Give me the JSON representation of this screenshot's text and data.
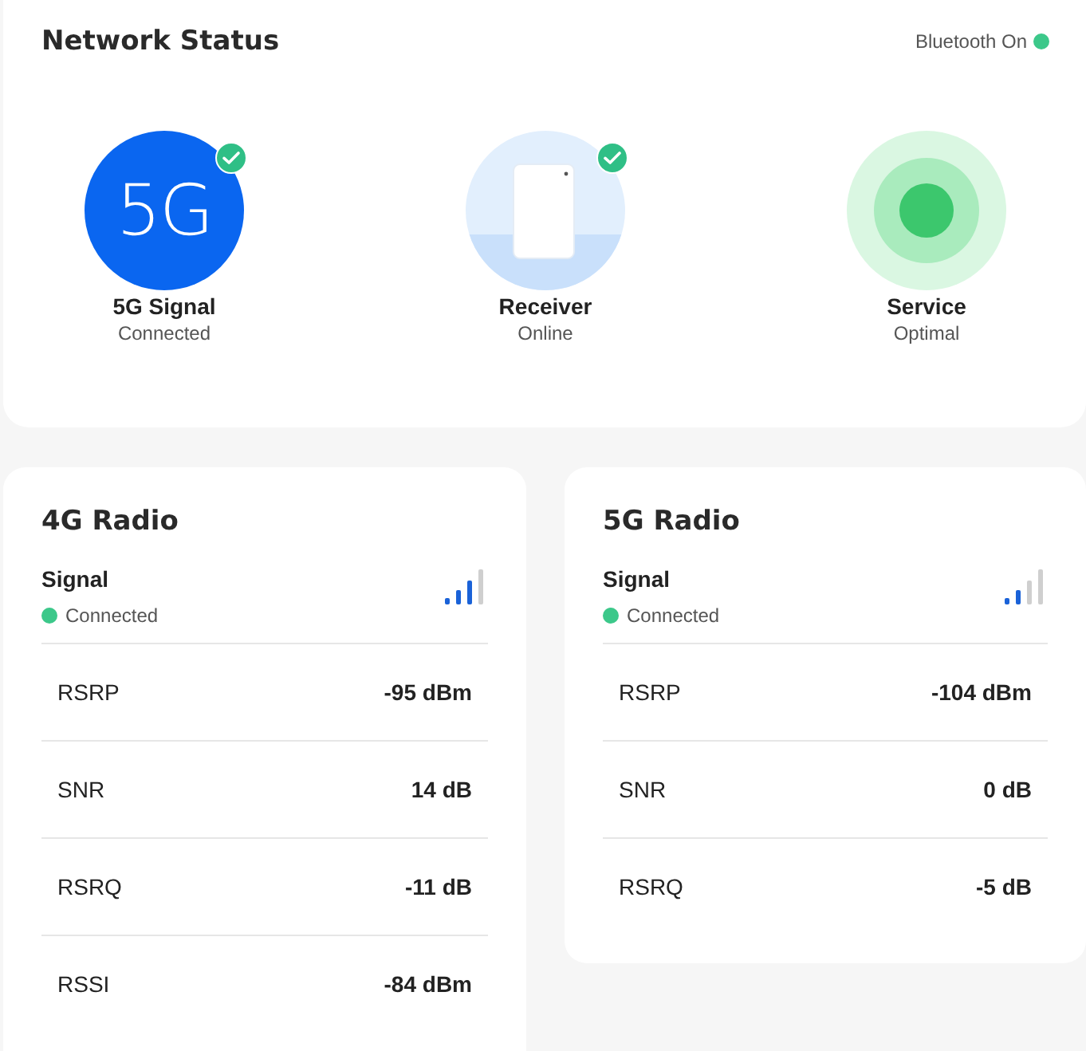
{
  "header": {
    "title": "Network Status",
    "bluetooth_label": "Bluetooth On"
  },
  "status_items": [
    {
      "kind": "fiveg",
      "badge_text": "5G",
      "label": "5G Signal",
      "status": "Connected",
      "verified": true
    },
    {
      "kind": "receiver",
      "label": "Receiver",
      "status": "Online",
      "verified": true
    },
    {
      "kind": "service",
      "label": "Service",
      "status": "Optimal",
      "verified": false
    }
  ],
  "radios": [
    {
      "title": "4G Radio",
      "signal": {
        "label": "Signal",
        "status": "Connected",
        "kind": "strong"
      },
      "metrics": [
        {
          "name": "RSRP",
          "value": "-95 dBm"
        },
        {
          "name": "SNR",
          "value": "14 dB"
        },
        {
          "name": "RSRQ",
          "value": "-11 dB"
        },
        {
          "name": "RSSI",
          "value": "-84 dBm"
        }
      ]
    },
    {
      "title": "5G Radio",
      "signal": {
        "label": "Signal",
        "status": "Connected",
        "kind": "weak"
      },
      "metrics": [
        {
          "name": "RSRP",
          "value": "-104 dBm"
        },
        {
          "name": "SNR",
          "value": "0 dB"
        },
        {
          "name": "RSRQ",
          "value": "-5 dB"
        }
      ]
    }
  ]
}
